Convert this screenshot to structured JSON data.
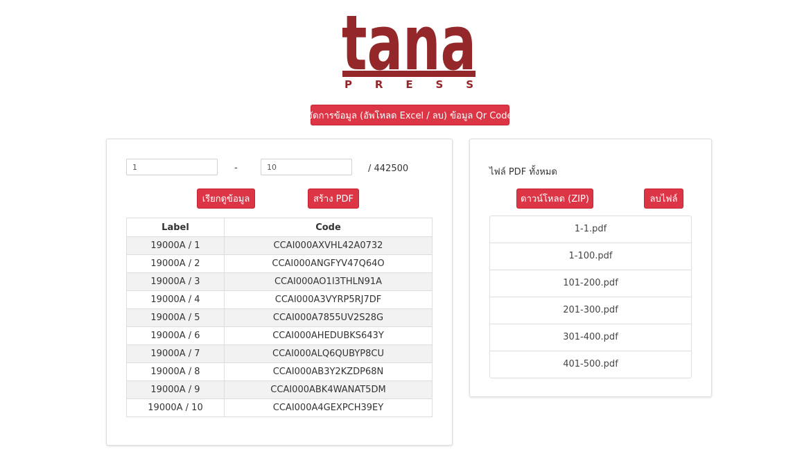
{
  "logo": {
    "main_text": "tana",
    "sub_text": "P R E S S",
    "color": "#93272a"
  },
  "toolbar": {
    "manage_label": "จัดการข้อมูล (อัพโหลด Excel / ลบ) ข้อมูล Qr Code"
  },
  "range": {
    "from_value": "1",
    "separator": "-",
    "to_value": "10",
    "total": "/ 442500"
  },
  "actions": {
    "fetch_label": "เรียกดูข้อมูล",
    "create_pdf_label": "สร้าง PDF"
  },
  "table": {
    "headers": [
      "Label",
      "Code"
    ],
    "rows": [
      {
        "label": "19000A / 1",
        "code": "CCAI000AXVHL42A0732"
      },
      {
        "label": "19000A / 2",
        "code": "CCAI000ANGFYV47Q64O"
      },
      {
        "label": "19000A / 3",
        "code": "CCAI000AO1I3THLN91A"
      },
      {
        "label": "19000A / 4",
        "code": "CCAI000A3VYRP5RJ7DF"
      },
      {
        "label": "19000A / 5",
        "code": "CCAI000A7855UV2S28G"
      },
      {
        "label": "19000A / 6",
        "code": "CCAI000AHEDUBKS643Y"
      },
      {
        "label": "19000A / 7",
        "code": "CCAI000ALQ6QUBYP8CU"
      },
      {
        "label": "19000A / 8",
        "code": "CCAI000AB3Y2KZDP68N"
      },
      {
        "label": "19000A / 9",
        "code": "CCAI000ABK4WANAT5DM"
      },
      {
        "label": "19000A / 10",
        "code": "CCAI000A4GEXPCH39EY"
      }
    ]
  },
  "files_panel": {
    "title": "ไฟล์ PDF ทั้งหมด",
    "download_label": "ดาวน์โหลด (ZIP)",
    "delete_label": "ลบไฟล์",
    "files": [
      "1-1.pdf",
      "1-100.pdf",
      "101-200.pdf",
      "201-300.pdf",
      "301-400.pdf",
      "401-500.pdf"
    ]
  },
  "colors": {
    "accent": "#dc3545",
    "brand": "#93272a"
  }
}
